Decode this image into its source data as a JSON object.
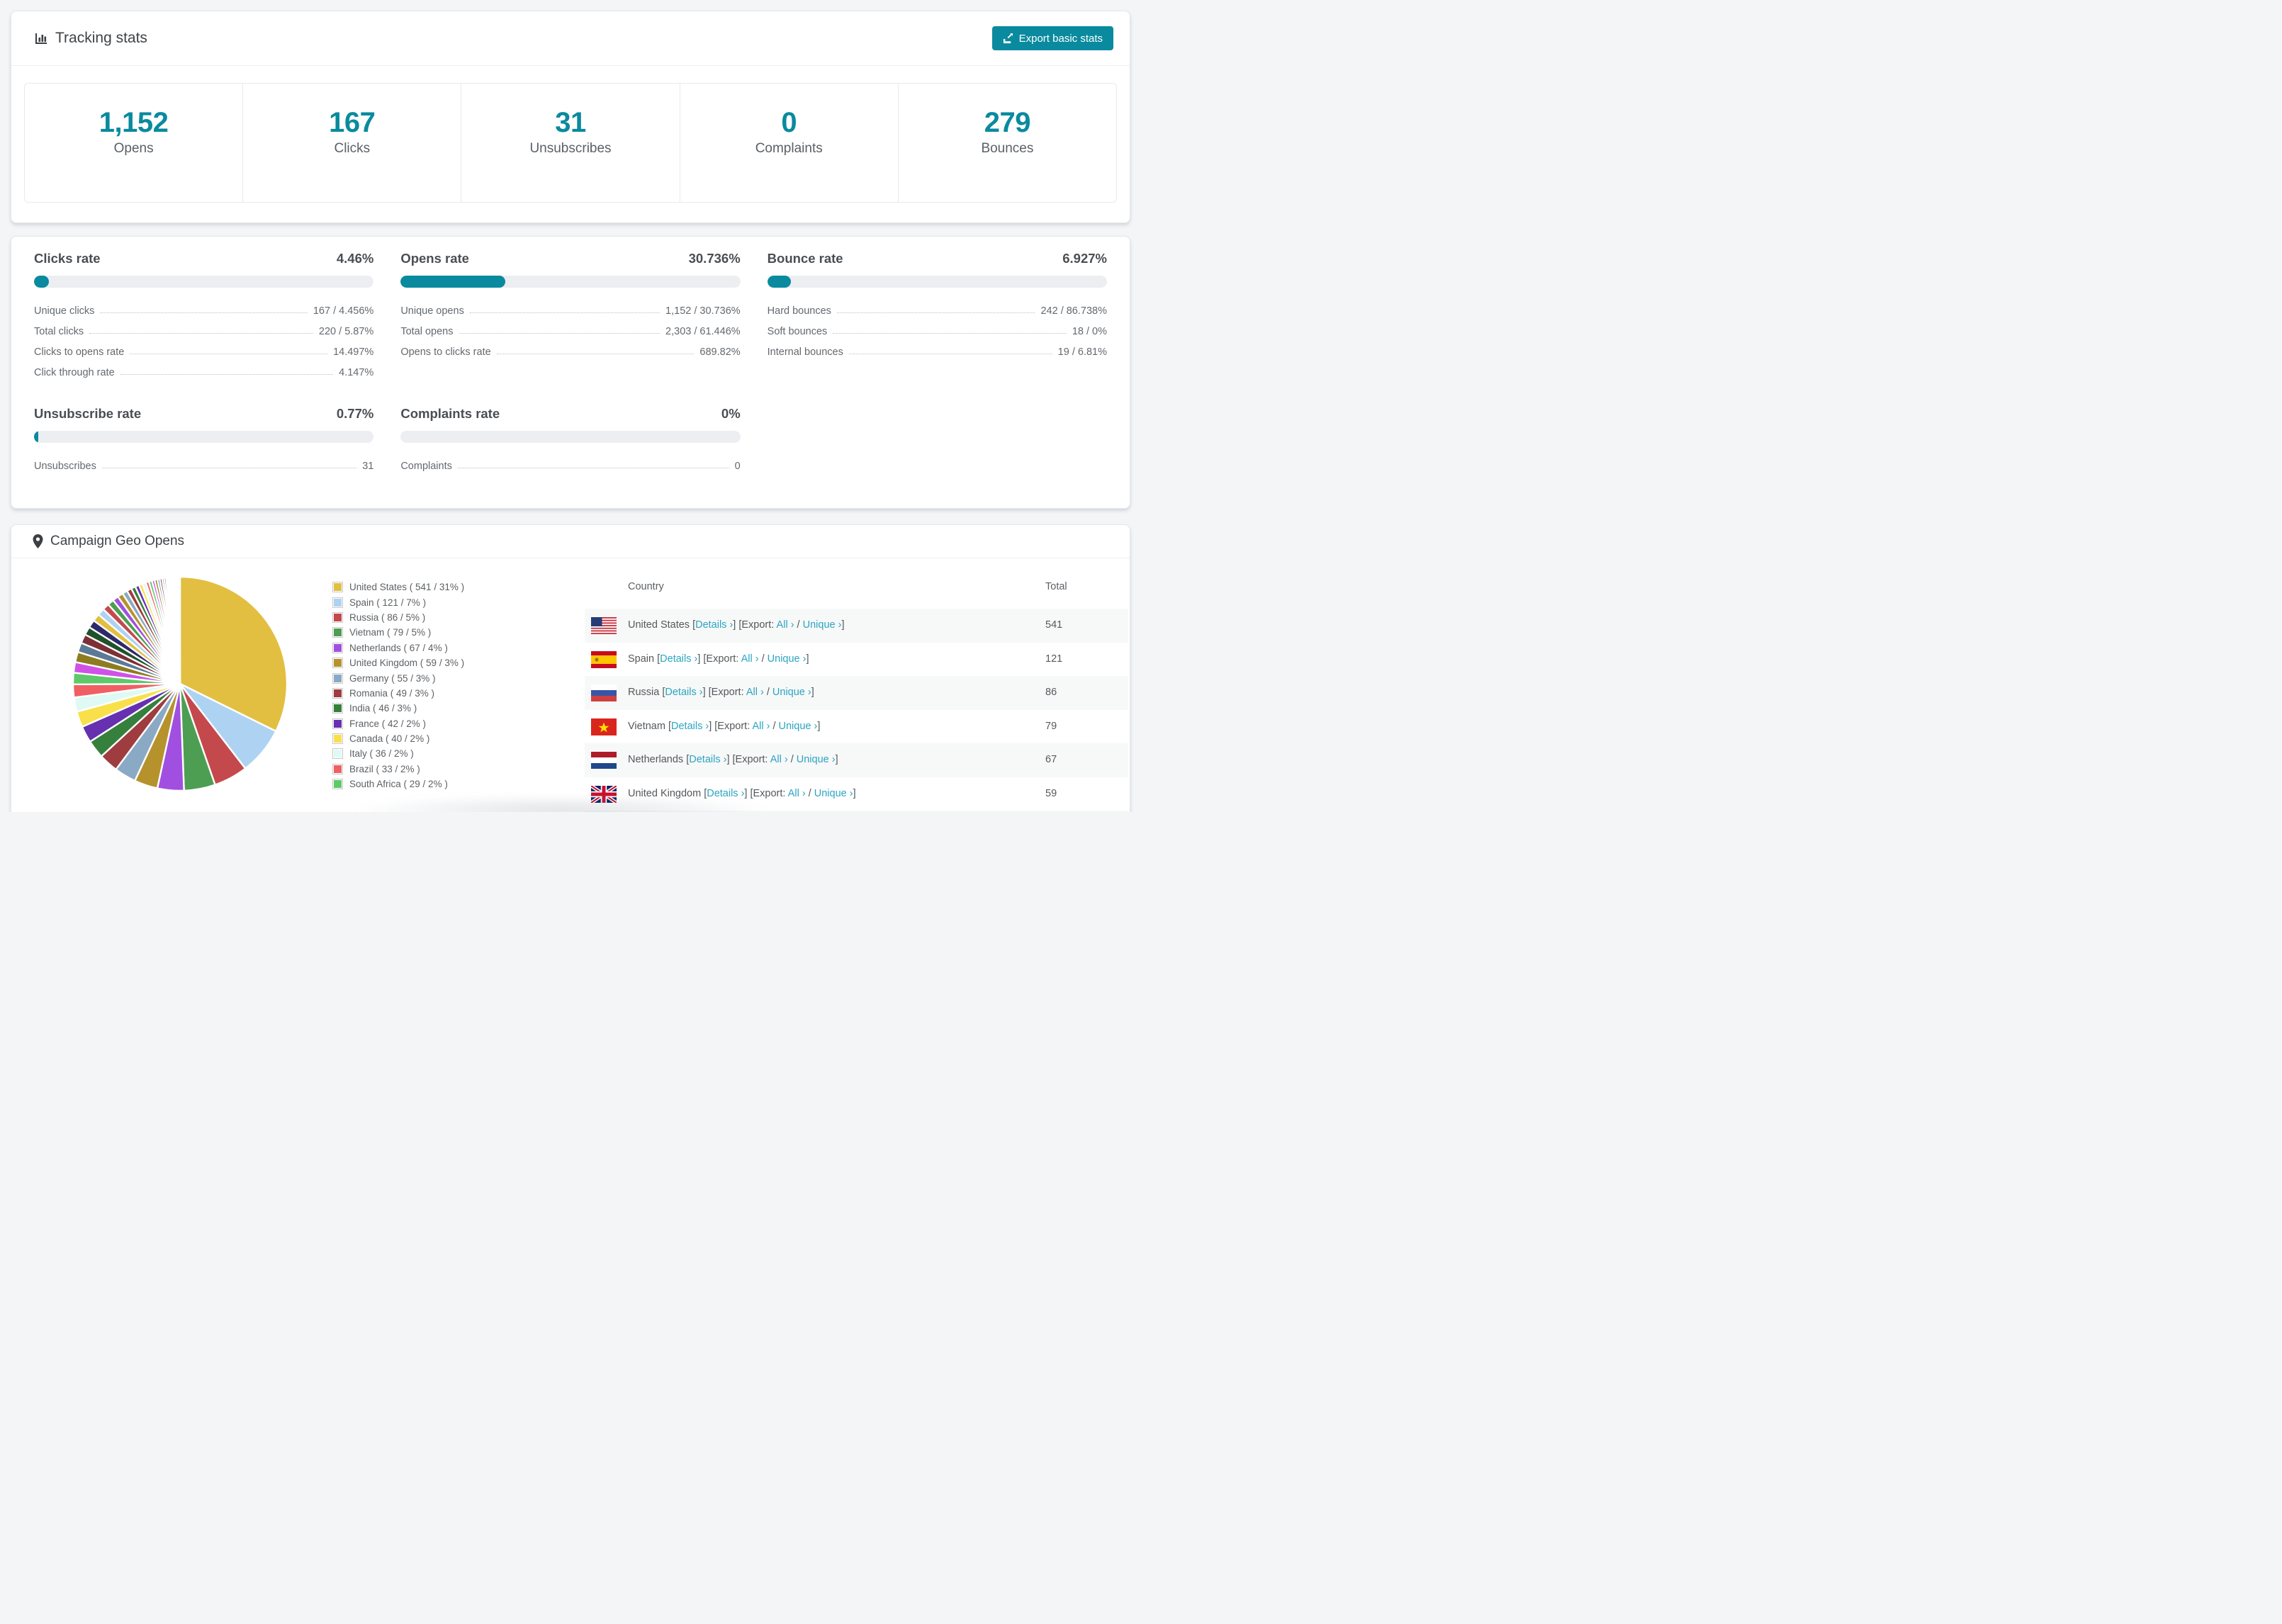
{
  "colors": {
    "accent": "#0a8a9e",
    "link": "#2aa5c2",
    "row_alt": "#f7f8f8",
    "track": "#eceef1"
  },
  "tracking": {
    "title": "Tracking stats",
    "export_button_label": "Export basic stats",
    "summary": [
      {
        "value": "1,152",
        "label": "Opens"
      },
      {
        "value": "167",
        "label": "Clicks"
      },
      {
        "value": "31",
        "label": "Unsubscribes"
      },
      {
        "value": "0",
        "label": "Complaints"
      },
      {
        "value": "279",
        "label": "Bounces"
      }
    ]
  },
  "rates": [
    {
      "title": "Clicks rate",
      "value": "4.46%",
      "percent": 4.46,
      "rows": [
        {
          "label": "Unique clicks",
          "value": "167 / 4.456%"
        },
        {
          "label": "Total clicks",
          "value": "220 / 5.87%"
        },
        {
          "label": "Clicks to opens rate",
          "value": "14.497%"
        },
        {
          "label": "Click through rate",
          "value": "4.147%"
        }
      ]
    },
    {
      "title": "Opens rate",
      "value": "30.736%",
      "percent": 30.736,
      "rows": [
        {
          "label": "Unique opens",
          "value": "1,152 / 30.736%"
        },
        {
          "label": "Total opens",
          "value": "2,303 / 61.446%"
        },
        {
          "label": "Opens to clicks rate",
          "value": "689.82%"
        }
      ]
    },
    {
      "title": "Bounce rate",
      "value": "6.927%",
      "percent": 6.927,
      "rows": [
        {
          "label": "Hard bounces",
          "value": "242 / 86.738%"
        },
        {
          "label": "Soft bounces",
          "value": "18 / 0%"
        },
        {
          "label": "Internal bounces",
          "value": "19 / 6.81%"
        }
      ]
    },
    {
      "title": "Unsubscribe rate",
      "value": "0.77%",
      "percent": 0.77,
      "rows": [
        {
          "label": "Unsubscribes",
          "value": "31"
        }
      ]
    },
    {
      "title": "Complaints rate",
      "value": "0%",
      "percent": 0,
      "rows": [
        {
          "label": "Complaints",
          "value": "0"
        }
      ]
    }
  ],
  "geo": {
    "title": "Campaign Geo Opens",
    "table": {
      "columns": [
        "Country",
        "Total"
      ],
      "link_labels": {
        "details": "Details ›",
        "all": "All ›",
        "unique": "Unique ›"
      },
      "brackets": {
        "b1": "[",
        "b2": "] [Export: ",
        "b3": " / ",
        "b4": "]"
      },
      "rows": [
        {
          "country": "United States",
          "flag": "us",
          "total": "541"
        },
        {
          "country": "Spain",
          "flag": "es",
          "total": "121"
        },
        {
          "country": "Russia",
          "flag": "ru",
          "total": "86"
        },
        {
          "country": "Vietnam",
          "flag": "vn",
          "total": "79"
        },
        {
          "country": "Netherlands",
          "flag": "nl",
          "total": "67"
        },
        {
          "country": "United Kingdom",
          "flag": "gb",
          "total": "59"
        },
        {
          "country": "",
          "flag": "de",
          "total": "",
          "partial": true
        }
      ]
    }
  },
  "chart_data": {
    "type": "pie",
    "title": "Campaign Geo Opens",
    "unit": "opens",
    "legend_position": "right",
    "start_angle_deg": -90,
    "direction": "clockwise",
    "slices": [
      {
        "label": "United States",
        "value": 541,
        "pct_label": "31%",
        "color": "#e2bf41"
      },
      {
        "label": "Spain",
        "value": 121,
        "pct_label": "7%",
        "color": "#aed3f2"
      },
      {
        "label": "Russia",
        "value": 86,
        "pct_label": "5%",
        "color": "#c4494d"
      },
      {
        "label": "Vietnam",
        "value": 79,
        "pct_label": "5%",
        "color": "#4d9e52"
      },
      {
        "label": "Netherlands",
        "value": 67,
        "pct_label": "4%",
        "color": "#a14fe0"
      },
      {
        "label": "United Kingdom",
        "value": 59,
        "pct_label": "3%",
        "color": "#b5922c"
      },
      {
        "label": "Germany",
        "value": 55,
        "pct_label": "3%",
        "color": "#8aa9c4"
      },
      {
        "label": "Romania",
        "value": 49,
        "pct_label": "3%",
        "color": "#9e3c3f"
      },
      {
        "label": "India",
        "value": 46,
        "pct_label": "3%",
        "color": "#35803c"
      },
      {
        "label": "France",
        "value": 42,
        "pct_label": "2%",
        "color": "#6630b0"
      },
      {
        "label": "Canada",
        "value": 40,
        "pct_label": "2%",
        "color": "#f9e04b"
      },
      {
        "label": "Italy",
        "value": 36,
        "pct_label": "2%",
        "color": "#dffaf4"
      },
      {
        "label": "Brazil",
        "value": 33,
        "pct_label": "2%",
        "color": "#f05f63"
      },
      {
        "label": "South Africa",
        "value": 29,
        "pct_label": "2%",
        "color": "#5ec969"
      }
    ],
    "other_slices_values": [
      27,
      26,
      24,
      23,
      21,
      20,
      19,
      18,
      17,
      16,
      15,
      14,
      13,
      12,
      11,
      10,
      9,
      9,
      8,
      8,
      7,
      7,
      6,
      6,
      5,
      5,
      4,
      4,
      4,
      3,
      3,
      3,
      2,
      2,
      2,
      2,
      1,
      1,
      1,
      1,
      1,
      1
    ],
    "palette": [
      "#e2bf41",
      "#aed3f2",
      "#c4494d",
      "#4d9e52",
      "#a14fe0",
      "#b5922c",
      "#8aa9c4",
      "#9e3c3f",
      "#35803c",
      "#6630b0",
      "#f9e04b",
      "#dffaf4",
      "#f05f63",
      "#5ec969",
      "#cf52e8",
      "#8d7c20",
      "#5c7a96",
      "#7e2f36",
      "#20512b",
      "#2c2a6b"
    ]
  }
}
